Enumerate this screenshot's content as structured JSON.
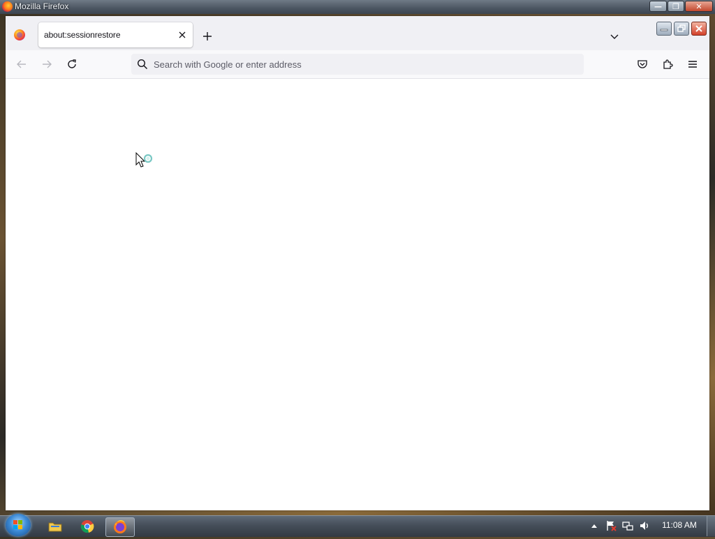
{
  "window": {
    "title": "Mozilla Firefox"
  },
  "tabs": [
    {
      "title": "about:sessionrestore"
    }
  ],
  "navbar": {
    "url_placeholder": "Search with Google or enter address"
  },
  "taskbar": {
    "apps": [
      "file-explorer",
      "chrome",
      "firefox"
    ],
    "clock": "11:08 AM"
  },
  "colors": {
    "tabstrip": "#f0f0f4",
    "navbar": "#f9f9fb",
    "urlbar": "#f0f0f4",
    "text": "#15141a",
    "placeholder": "#5b5b66"
  }
}
